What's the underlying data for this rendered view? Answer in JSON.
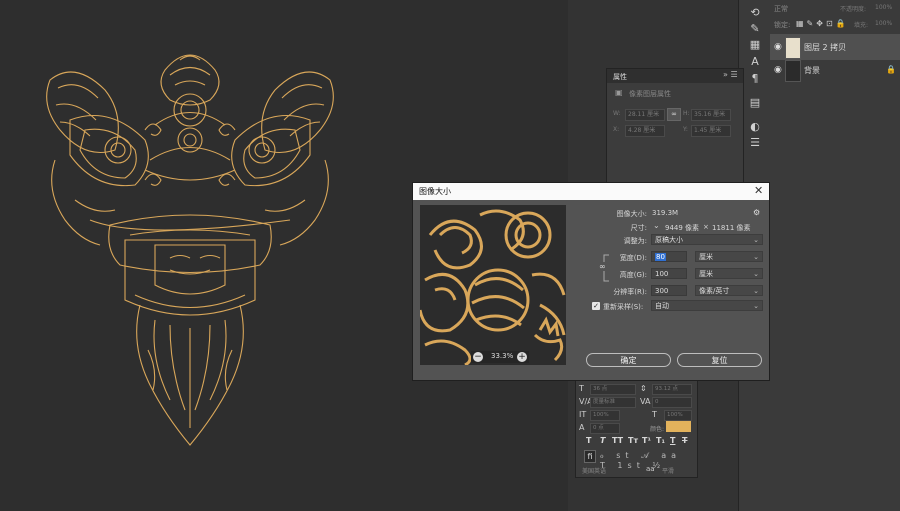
{
  "properties_panel": {
    "title": "属性",
    "subtitle": "像素图层属性",
    "w_label": "W:",
    "w_value": "28.11 厘米",
    "h_label": "H:",
    "h_value": "35.16 厘米",
    "x_label": "X:",
    "x_value": "4.28 厘米",
    "y_label": "Y:",
    "y_value": "1.45 厘米"
  },
  "layers_panel": {
    "blend_mode": "正常",
    "opacity_label": "不透明度:",
    "opacity_value": "100%",
    "lock_label": "锁定:",
    "fill_label": "填充:",
    "fill_value": "100%",
    "layers": [
      {
        "name": "图层 2 拷贝"
      },
      {
        "name": "背景"
      }
    ]
  },
  "dialog": {
    "title": "图像大小",
    "image_size_label": "图像大小:",
    "image_size_value": "319.3M",
    "dimensions_label": "尺寸:",
    "dimensions_w": "9449 像素",
    "dimensions_x": "×",
    "dimensions_h": "11811 像素",
    "fit_label": "调整为:",
    "fit_value": "原稿大小",
    "width_label": "宽度(D):",
    "width_value": "80",
    "width_unit": "厘米",
    "height_label": "高度(G):",
    "height_value": "100",
    "height_unit": "厘米",
    "resolution_label": "分辨率(R):",
    "resolution_value": "300",
    "resolution_unit": "像素/英寸",
    "resample_label": "重新采样(S):",
    "resample_value": "自动",
    "zoom": "33.3%",
    "ok_label": "确定",
    "reset_label": "复位"
  },
  "character_panel": {
    "font_size": "36 点",
    "leading": "93.12 点",
    "kerning": "度量标准",
    "tracking": "0",
    "vscale": "100%",
    "hscale": "100%",
    "baseline": "0 点",
    "color_label": "颜色:",
    "color": "#e2b25c",
    "language": "美国英语",
    "aa": "aa",
    "sharp": "平滑"
  },
  "colors": {
    "art": "#d9a75a",
    "accent": "#2f6fd1"
  }
}
